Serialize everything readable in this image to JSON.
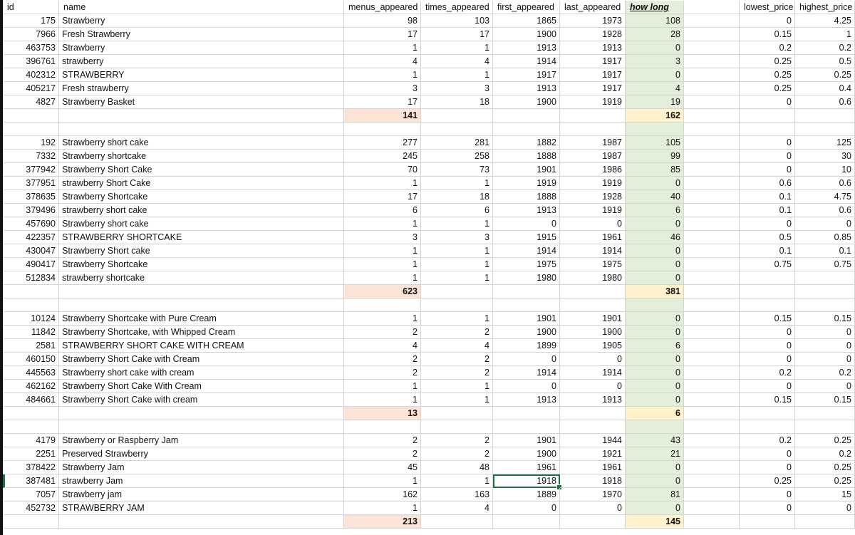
{
  "columns": [
    "id",
    "name",
    "menus_appeared",
    "times_appeared",
    "first_appeared",
    "last_appeared",
    "how long",
    "",
    "lowest_price",
    "highest_price"
  ],
  "rows": [
    {
      "id": "175",
      "name": "Strawberry",
      "menus": "98",
      "times": "103",
      "first": "1865",
      "last": "1973",
      "how": "108",
      "low": "0",
      "high": "4.25"
    },
    {
      "id": "7966",
      "name": "Fresh Strawberry",
      "menus": "17",
      "times": "17",
      "first": "1900",
      "last": "1928",
      "how": "28",
      "low": "0.15",
      "high": "1"
    },
    {
      "id": "463753",
      "name": "Strawberry",
      "menus": "1",
      "times": "1",
      "first": "1913",
      "last": "1913",
      "how": "0",
      "low": "0.2",
      "high": "0.2"
    },
    {
      "id": "396761",
      "name": "strawberry",
      "menus": "4",
      "times": "4",
      "first": "1914",
      "last": "1917",
      "how": "3",
      "low": "0.25",
      "high": "0.5"
    },
    {
      "id": "402312",
      "name": "STRAWBERRY",
      "menus": "1",
      "times": "1",
      "first": "1917",
      "last": "1917",
      "how": "0",
      "low": "0.25",
      "high": "0.25"
    },
    {
      "id": "405217",
      "name": "Fresh strawberry",
      "menus": "3",
      "times": "3",
      "first": "1913",
      "last": "1917",
      "how": "4",
      "low": "0.25",
      "high": "0.4"
    },
    {
      "id": "4827",
      "name": "Strawberry Basket",
      "menus": "17",
      "times": "18",
      "first": "1900",
      "last": "1919",
      "how": "19",
      "low": "0",
      "high": "0.6"
    },
    {
      "sum": true,
      "menus": "141",
      "how": "162"
    },
    {
      "blank": true
    },
    {
      "id": "192",
      "name": "Strawberry short cake",
      "menus": "277",
      "times": "281",
      "first": "1882",
      "last": "1987",
      "how": "105",
      "low": "0",
      "high": "125"
    },
    {
      "id": "7332",
      "name": "Strawberry shortcake",
      "menus": "245",
      "times": "258",
      "first": "1888",
      "last": "1987",
      "how": "99",
      "low": "0",
      "high": "30"
    },
    {
      "id": "377942",
      "name": "Strawberry Short Cake",
      "menus": "70",
      "times": "73",
      "first": "1901",
      "last": "1986",
      "how": "85",
      "low": "0",
      "high": "10"
    },
    {
      "id": "377951",
      "name": "strawberry Short Cake",
      "menus": "1",
      "times": "1",
      "first": "1919",
      "last": "1919",
      "how": "0",
      "low": "0.6",
      "high": "0.6"
    },
    {
      "id": "378635",
      "name": "Strawberry Shortcake",
      "menus": "17",
      "times": "18",
      "first": "1888",
      "last": "1928",
      "how": "40",
      "low": "0.1",
      "high": "4.75"
    },
    {
      "id": "379496",
      "name": "strawberry short cake",
      "menus": "6",
      "times": "6",
      "first": "1913",
      "last": "1919",
      "how": "6",
      "low": "0.1",
      "high": "0.6"
    },
    {
      "id": "457690",
      "name": "Strawberry short cake",
      "menus": "1",
      "times": "1",
      "first": "0",
      "last": "0",
      "how": "0",
      "low": "0",
      "high": "0"
    },
    {
      "id": "422357",
      "name": "STRAWBERRY SHORTCAKE",
      "menus": "3",
      "times": "3",
      "first": "1915",
      "last": "1961",
      "how": "46",
      "low": "0.5",
      "high": "0.85"
    },
    {
      "id": "430047",
      "name": "Strawberry Short cake",
      "menus": "1",
      "times": "1",
      "first": "1914",
      "last": "1914",
      "how": "0",
      "low": "0.1",
      "high": "0.1"
    },
    {
      "id": "490417",
      "name": "Strawberry Shortcake",
      "menus": "1",
      "times": "1",
      "first": "1975",
      "last": "1975",
      "how": "0",
      "low": "0.75",
      "high": "0.75"
    },
    {
      "id": "512834",
      "name": "strawberry shortcake",
      "menus": "1",
      "times": "1",
      "first": "1980",
      "last": "1980",
      "how": "0",
      "low": "",
      "high": ""
    },
    {
      "sum": true,
      "menus": "623",
      "how": "381"
    },
    {
      "blank": true
    },
    {
      "id": "10124",
      "name": "Strawberry Shortcake with Pure Cream",
      "menus": "1",
      "times": "1",
      "first": "1901",
      "last": "1901",
      "how": "0",
      "low": "0.15",
      "high": "0.15"
    },
    {
      "id": "11842",
      "name": "Strawberry Shortcake, with Whipped Cream",
      "menus": "2",
      "times": "2",
      "first": "1900",
      "last": "1900",
      "how": "0",
      "low": "0",
      "high": "0"
    },
    {
      "id": "2581",
      "name": "STRAWBERRY SHORT CAKE WITH CREAM",
      "menus": "4",
      "times": "4",
      "first": "1899",
      "last": "1905",
      "how": "6",
      "low": "0",
      "high": "0"
    },
    {
      "id": "460150",
      "name": "Strawberry Short Cake with Cream",
      "menus": "2",
      "times": "2",
      "first": "0",
      "last": "0",
      "how": "0",
      "low": "0",
      "high": "0"
    },
    {
      "id": "445563",
      "name": "Strawberry short cake with cream",
      "menus": "2",
      "times": "2",
      "first": "1914",
      "last": "1914",
      "how": "0",
      "low": "0.2",
      "high": "0.2"
    },
    {
      "id": "462162",
      "name": "Strawberry Short Cake With Cream",
      "menus": "1",
      "times": "1",
      "first": "0",
      "last": "0",
      "how": "0",
      "low": "0",
      "high": "0"
    },
    {
      "id": "484661",
      "name": "Strawberry Short Cake with cream",
      "menus": "1",
      "times": "1",
      "first": "1913",
      "last": "1913",
      "how": "0",
      "low": "0.15",
      "high": "0.15"
    },
    {
      "sum": true,
      "menus": "13",
      "how": "6"
    },
    {
      "blank": true
    },
    {
      "id": "4179",
      "name": "Strawberry or Raspberry Jam",
      "menus": "2",
      "times": "2",
      "first": "1901",
      "last": "1944",
      "how": "43",
      "low": "0.2",
      "high": "0.25"
    },
    {
      "id": "2251",
      "name": "Preserved Strawberry",
      "menus": "2",
      "times": "2",
      "first": "1900",
      "last": "1921",
      "how": "21",
      "low": "0",
      "high": "0.2"
    },
    {
      "id": "378422",
      "name": "Strawberry Jam",
      "menus": "45",
      "times": "48",
      "first": "1961",
      "last": "1961",
      "how": "0",
      "low": "0",
      "high": "0.25"
    },
    {
      "id": "387481",
      "name": "strawberry Jam",
      "menus": "1",
      "times": "1",
      "first": "1918",
      "last": "1918",
      "how": "0",
      "low": "0.25",
      "high": "0.25",
      "selected": true
    },
    {
      "id": "7057",
      "name": "Strawberry jam",
      "menus": "162",
      "times": "163",
      "first": "1889",
      "last": "1970",
      "how": "81",
      "low": "0",
      "high": "15"
    },
    {
      "id": "452732",
      "name": "STRAWBERRY JAM",
      "menus": "1",
      "times": "4",
      "first": "0",
      "last": "0",
      "how": "0",
      "low": "0",
      "high": "0"
    },
    {
      "sum": true,
      "menus": "213",
      "how": "145"
    }
  ],
  "colors": {
    "how_long_fill": "#e3efd9",
    "sum_menus_fill": "#fbe3d6",
    "sum_how_fill": "#fff2cc",
    "selection": "#1e7145"
  }
}
